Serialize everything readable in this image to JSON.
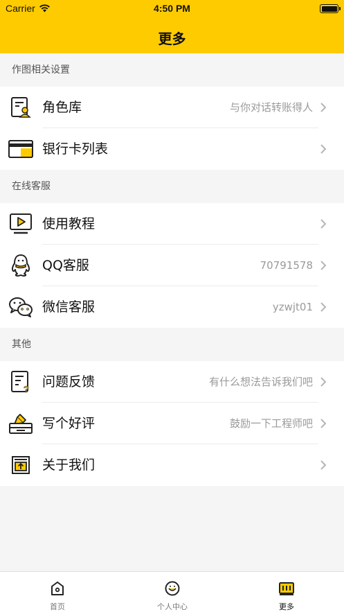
{
  "status_bar": {
    "carrier": "Carrier",
    "time": "4:50 PM"
  },
  "nav": {
    "title": "更多"
  },
  "sections": [
    {
      "header": "作图相关设置",
      "rows": [
        {
          "label": "角色库",
          "detail": "与你对话转账得人",
          "icon": "contact-card-icon"
        },
        {
          "label": "银行卡列表",
          "detail": "",
          "icon": "bank-card-icon"
        }
      ]
    },
    {
      "header": "在线客服",
      "rows": [
        {
          "label": "使用教程",
          "detail": "",
          "icon": "video-tutorial-icon"
        },
        {
          "label": "QQ客服",
          "detail": "70791578",
          "icon": "qq-penguin-icon"
        },
        {
          "label": "微信客服",
          "detail": "yzwjt01",
          "icon": "wechat-icon"
        }
      ]
    },
    {
      "header": "其他",
      "rows": [
        {
          "label": "问题反馈",
          "detail": "有什么想法告诉我们吧",
          "icon": "feedback-icon"
        },
        {
          "label": "写个好评",
          "detail": "鼓励一下工程师吧",
          "icon": "review-icon"
        },
        {
          "label": "关于我们",
          "detail": "",
          "icon": "about-icon"
        }
      ]
    }
  ],
  "tabbar": {
    "tabs": [
      {
        "label": "首页",
        "icon": "home-icon",
        "active": false
      },
      {
        "label": "个人中心",
        "icon": "profile-icon",
        "active": false
      },
      {
        "label": "更多",
        "icon": "more-icon",
        "active": true
      }
    ]
  },
  "colors": {
    "accent": "#fecb00",
    "background": "#f5f5f5",
    "detail_text": "#9a9a9a"
  }
}
